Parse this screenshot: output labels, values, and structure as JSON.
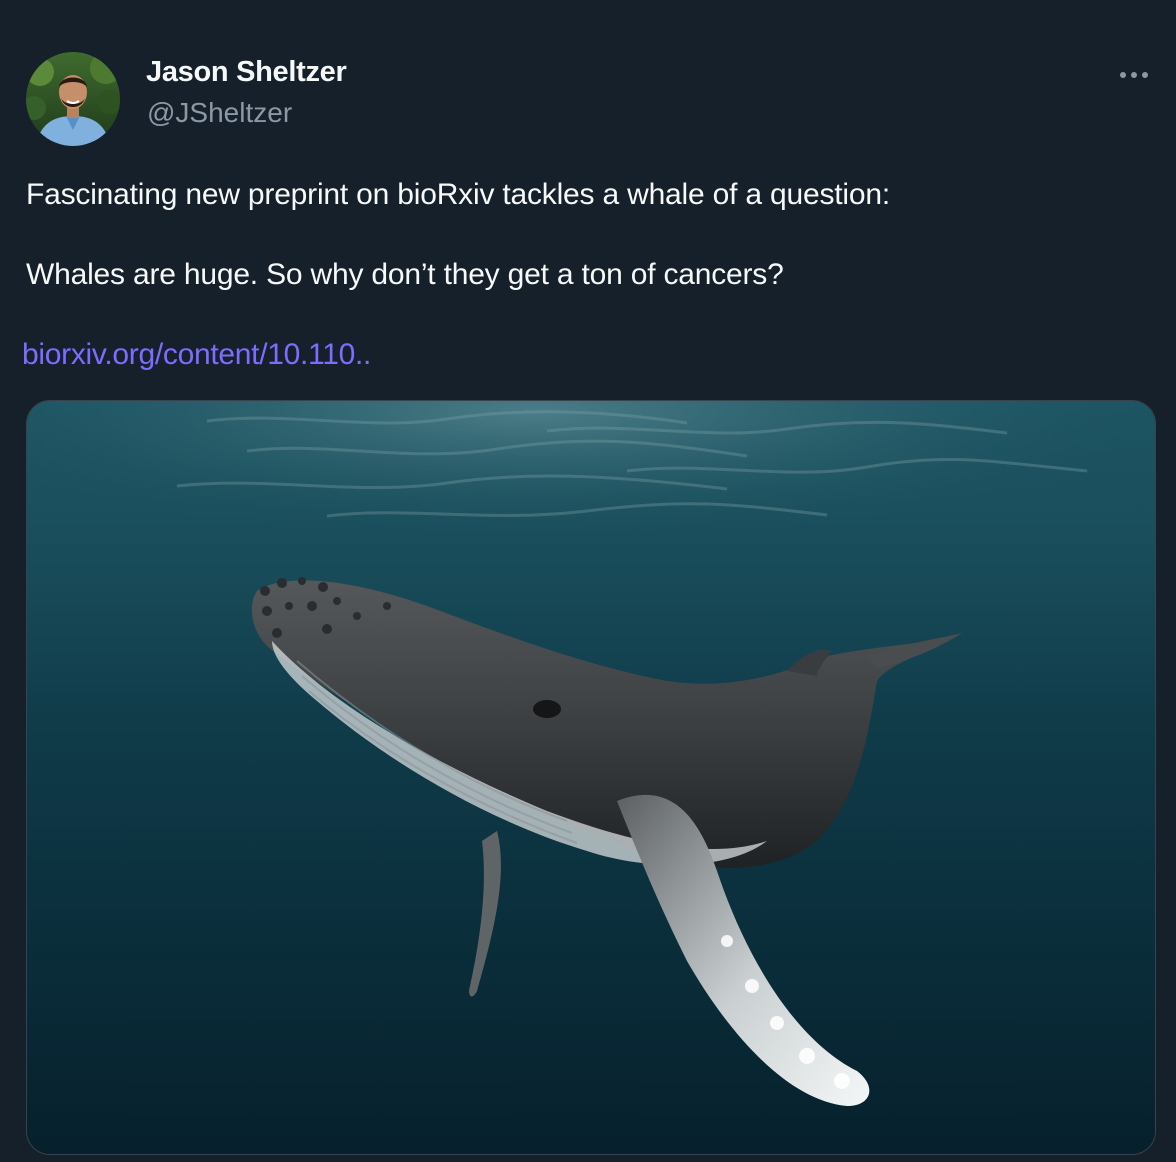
{
  "tweet": {
    "author": {
      "display_name": "Jason Sheltzer",
      "handle": "@JSheltzer",
      "avatar_icon": "profile-photo"
    },
    "more_icon": "more-horizontal-icon",
    "text_lines": [
      "Fascinating new preprint on bioRxiv tackles a whale of a question:",
      "Whales are huge. So why don’t they get a ton of cancers?"
    ],
    "link_text": "biorxiv.org/content/10.110..",
    "media": {
      "subject": "humpback whale underwater photo"
    }
  },
  "colors": {
    "background": "#15202b",
    "text_primary": "#f7f9f9",
    "text_secondary": "#8b98a5",
    "link": "#7e6bff",
    "border": "#38444d"
  }
}
